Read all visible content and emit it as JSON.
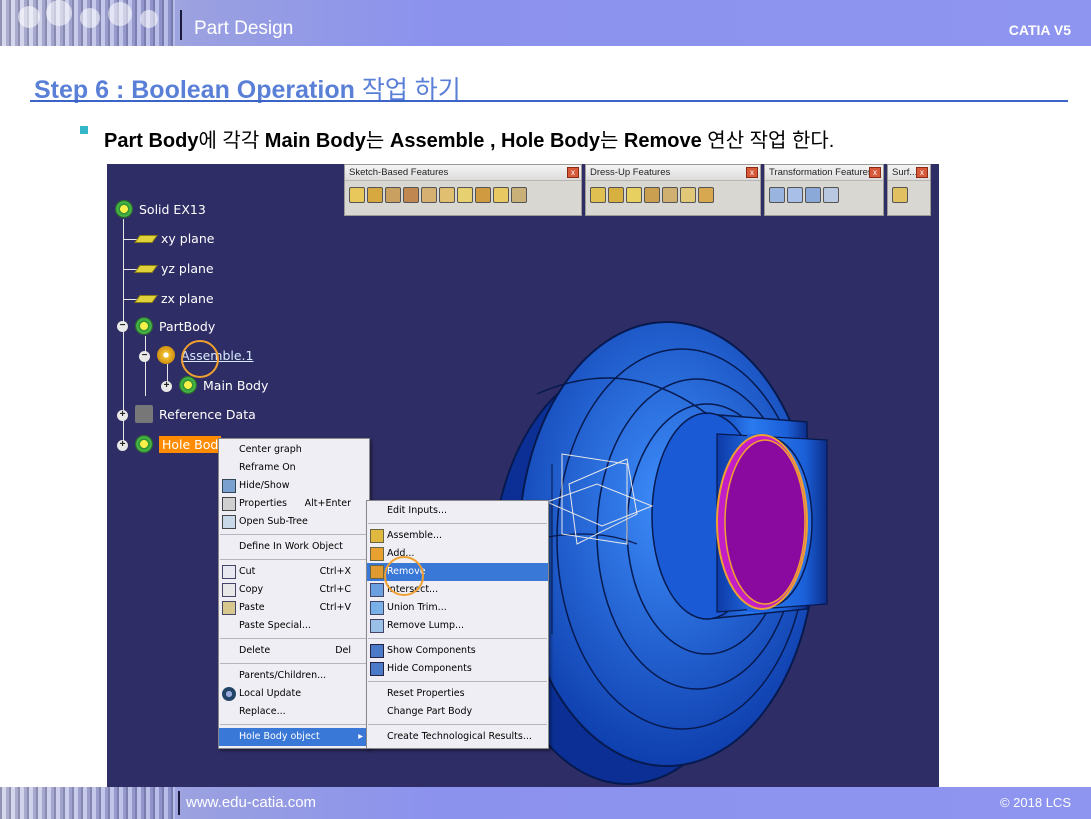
{
  "header": {
    "title": "Part Design",
    "right_label": "CATIA V5"
  },
  "footer": {
    "url": "www.edu-catia.com",
    "copyright": "© 2018 LCS"
  },
  "step": {
    "title_en": "Step 6 : Boolean Operation",
    "title_kr": "작업 하기"
  },
  "bullet": {
    "p1_bold": "Part Body",
    "p1": "에 각각 ",
    "p2_bold": "Main Body",
    "p2": "는 ",
    "p3_bold": "Assemble , Hole Body",
    "p3": "는 ",
    "p4_bold": "Remove",
    "p4": " 연산 작업 한다."
  },
  "toolbars": [
    {
      "title": "Sketch-Based Features",
      "close": "x"
    },
    {
      "title": "Dress-Up Features",
      "close": "x"
    },
    {
      "title": "Transformation Features",
      "close": "x"
    },
    {
      "title": "Surf...",
      "close": "x"
    }
  ],
  "tree": {
    "root": "Solid EX13",
    "xy": "xy plane",
    "yz": "yz plane",
    "zx": "zx plane",
    "partbody": "PartBody",
    "assemble": "Assemble.1",
    "mainbody": "Main Body",
    "reference": "Reference Data",
    "holebody": "Hole Bod"
  },
  "context_menu": {
    "items": [
      {
        "label": "Center graph"
      },
      {
        "label": "Reframe On"
      },
      {
        "label": "Hide/Show"
      },
      {
        "label": "Properties",
        "accel": "Alt+Enter"
      },
      {
        "label": "Open Sub-Tree"
      },
      {
        "label": "Define In Work Object"
      },
      {
        "label": "Cut",
        "accel": "Ctrl+X"
      },
      {
        "label": "Copy",
        "accel": "Ctrl+C"
      },
      {
        "label": "Paste",
        "accel": "Ctrl+V"
      },
      {
        "label": "Paste Special..."
      },
      {
        "label": "Delete",
        "accel": "Del"
      },
      {
        "label": "Parents/Children..."
      },
      {
        "label": "Local Update"
      },
      {
        "label": "Replace..."
      },
      {
        "label": "Hole Body object"
      }
    ]
  },
  "sub_menu": {
    "items": [
      {
        "label": "Edit Inputs..."
      },
      {
        "label": "Assemble..."
      },
      {
        "label": "Add..."
      },
      {
        "label": "Remove"
      },
      {
        "label": "Intersect..."
      },
      {
        "label": "Union Trim..."
      },
      {
        "label": "Remove Lump..."
      },
      {
        "label": "Show Components"
      },
      {
        "label": "Hide Components"
      },
      {
        "label": "Reset Properties"
      },
      {
        "label": "Change Part Body"
      },
      {
        "label": "Create Technological Results..."
      }
    ]
  },
  "colors": {
    "background": "#2f2d65",
    "accent_title": "#5a7fd6",
    "selection": "#ff8c00",
    "menu_highlight": "#3a78d8",
    "part_blue": "#1f63e0",
    "part_face": "#8a0aa0"
  }
}
